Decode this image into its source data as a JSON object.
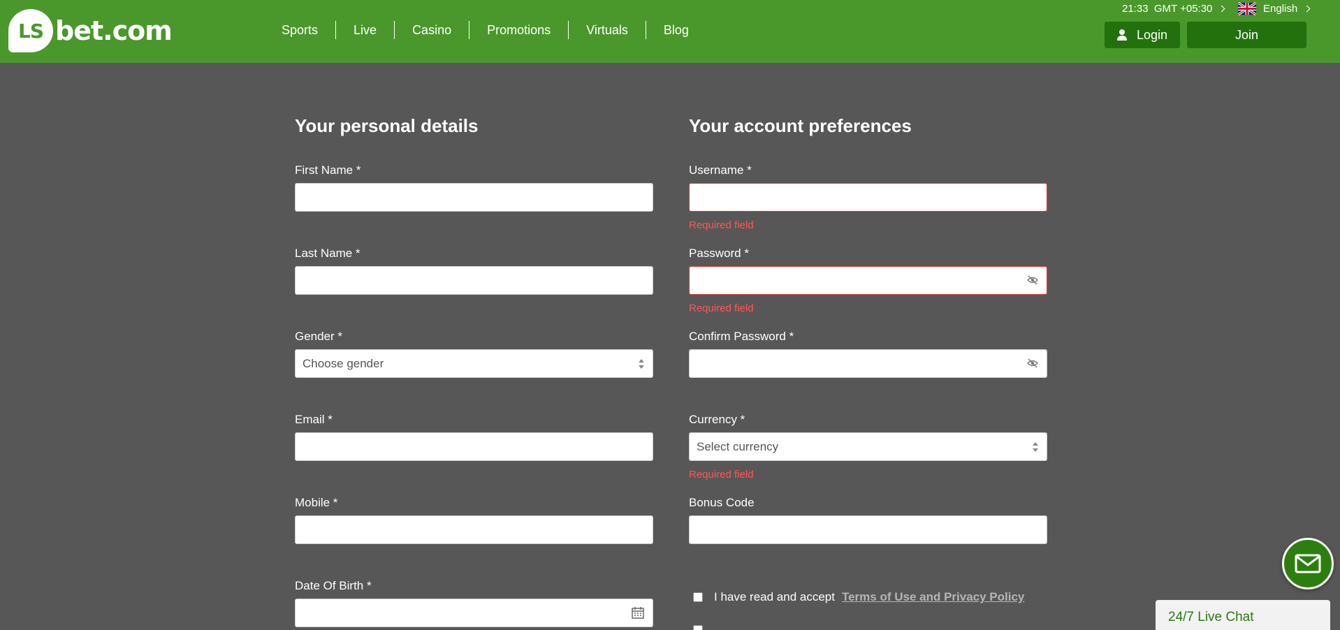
{
  "header": {
    "logo_badge": "LS",
    "logo_text": "bet.com",
    "nav": [
      "Sports",
      "Live",
      "Casino",
      "Promotions",
      "Virtuals",
      "Blog"
    ],
    "time": "21:33  GMT +05:30",
    "language": "English",
    "login_label": "Login",
    "join_label": "Join",
    "accent_color": "#4a982b",
    "button_color": "#22710c"
  },
  "personal": {
    "title": "Your personal details",
    "first_name": "First Name *",
    "last_name": "Last Name *",
    "gender": "Gender *",
    "gender_value": "Choose gender",
    "email": "Email *",
    "mobile": "Mobile *",
    "dob": "Date Of Birth *"
  },
  "account": {
    "title": "Your account preferences",
    "username": "Username *",
    "password": "Password *",
    "confirm_password": "Confirm Password *",
    "currency": "Currency *",
    "currency_value": "Select currency",
    "bonus_code": "Bonus Code",
    "required_error": "Required field",
    "terms_text": "I have read and accept",
    "terms_link": "Terms of Use and Privacy Policy"
  },
  "chat": {
    "label": "24/7 Live Chat"
  }
}
